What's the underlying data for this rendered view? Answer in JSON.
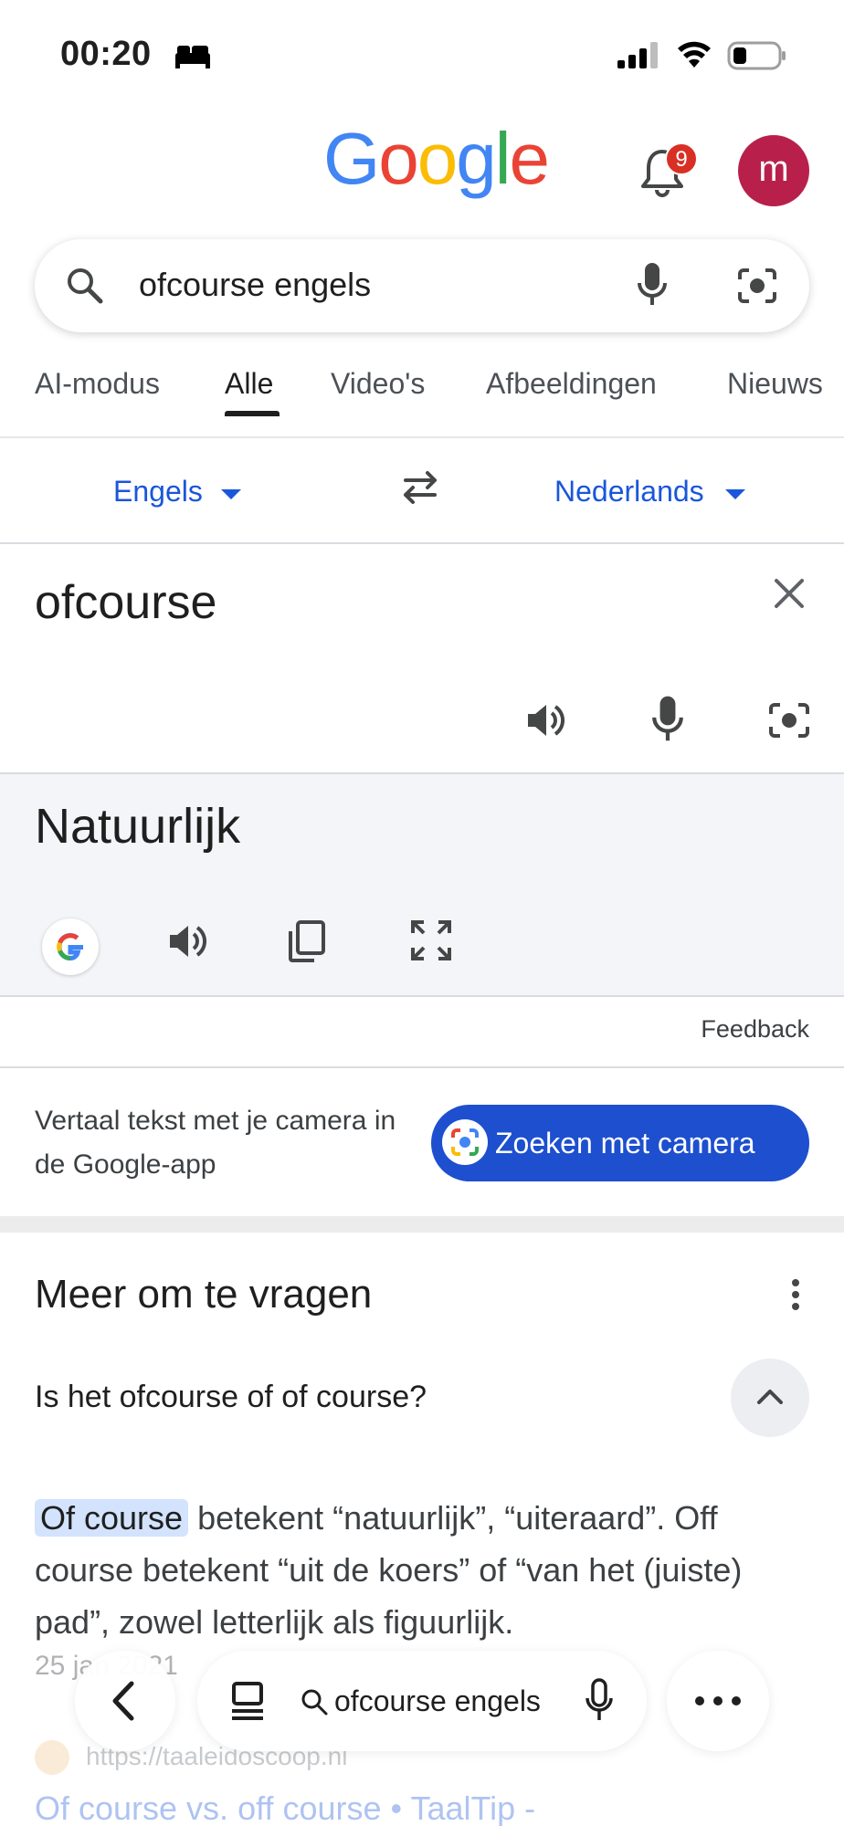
{
  "status_bar": {
    "time": "00:20"
  },
  "header": {
    "logo_letters": [
      {
        "char": "G",
        "color": "#4285F4"
      },
      {
        "char": "o",
        "color": "#EA4335"
      },
      {
        "char": "o",
        "color": "#FBBC05"
      },
      {
        "char": "g",
        "color": "#4285F4"
      },
      {
        "char": "l",
        "color": "#34A853"
      },
      {
        "char": "e",
        "color": "#EA4335"
      }
    ],
    "notification_count": "9",
    "avatar_initial": "m"
  },
  "search": {
    "query": "ofcourse engels"
  },
  "tabs": [
    "AI-modus",
    "Alle",
    "Video's",
    "Afbeeldingen",
    "Nieuws"
  ],
  "active_tab": "Alle",
  "translate": {
    "source_lang": "Engels",
    "target_lang": "Nederlands",
    "source_text": "ofcourse",
    "result_text": "Natuurlijk",
    "feedback": "Feedback",
    "promo_text": "Vertaal tekst met je camera in de Google-app",
    "camera_button": "Zoeken met camera"
  },
  "people_also_ask": {
    "title": "Meer om te vragen",
    "question": "Is het ofcourse of of course?",
    "answer_highlight": "Of course",
    "answer_rest": " betekent “natuurlijk”, “uiteraard”. Off course betekent “uit de koers” of “van het (juiste) pad”, zowel letterlijk als figuurlijk.",
    "date": "25 jan 2021",
    "source_url": "https://taaleidoscoop.nl",
    "source_title": "Of course vs. off course • TaalTip -"
  },
  "bottom_bar": {
    "query": "ofcourse engels"
  },
  "colors": {
    "accent_blue": "#1a56db",
    "camera_button_bg": "#1d4fcf",
    "avatar_bg": "#b8204b",
    "badge_bg": "#d93025",
    "highlight_bg": "#d3e3fd"
  }
}
